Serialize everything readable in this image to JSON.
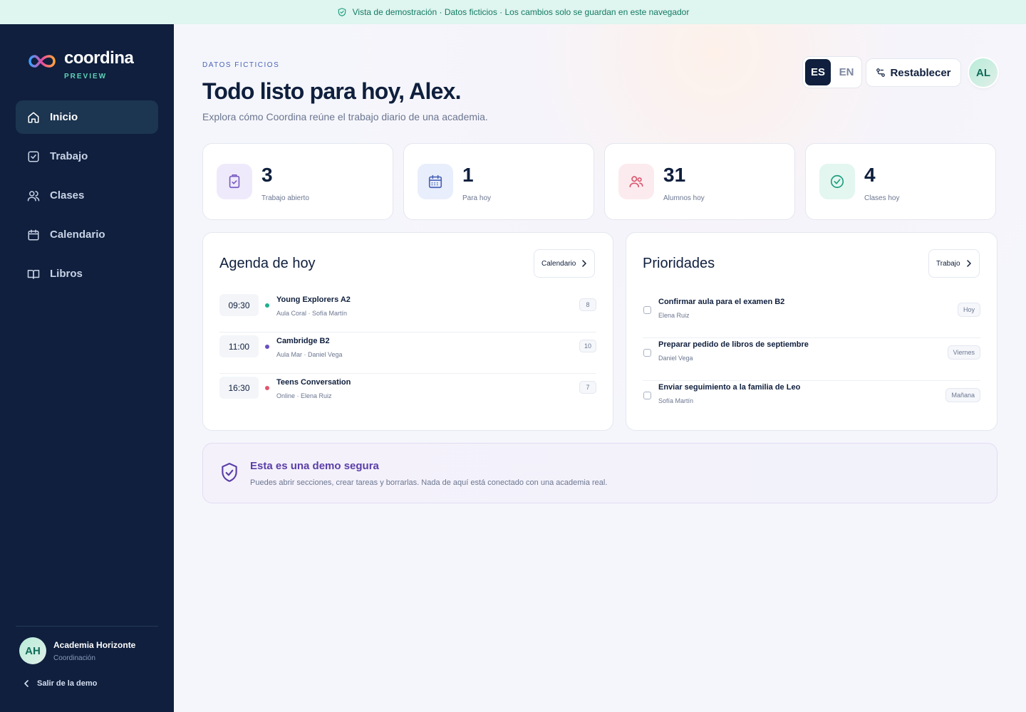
{
  "banner": {
    "text": "Vista de demostración · Datos ficticios · Los cambios solo se guardan en este navegador"
  },
  "brand": {
    "name": "coordina",
    "tag": "PREVIEW"
  },
  "sidebar": {
    "items": [
      {
        "label": "Inicio",
        "icon": "home-icon",
        "active": true
      },
      {
        "label": "Trabajo",
        "icon": "checkbox-icon"
      },
      {
        "label": "Clases",
        "icon": "users-icon"
      },
      {
        "label": "Calendario",
        "icon": "calendar-icon"
      },
      {
        "label": "Libros",
        "icon": "book-icon"
      }
    ],
    "org": {
      "initials": "AH",
      "name": "Academia Horizonte",
      "role": "Coordinación"
    },
    "exit_label": "Salir de la demo"
  },
  "header": {
    "eyebrow": "DATOS FICTICIOS",
    "title": "Todo listo para hoy, Alex.",
    "subtitle": "Explora cómo Coordina reúne el trabajo diario de una academia.",
    "lang_es": "ES",
    "lang_en": "EN",
    "reset_label": "Restablecer",
    "user_initials": "AL"
  },
  "stats": [
    {
      "value": "3",
      "label": "Trabajo abierto",
      "icon": "clipboard-check-icon",
      "color": "#7b5cc4"
    },
    {
      "value": "1",
      "label": "Para hoy",
      "icon": "calendar-icon",
      "color": "#4a63b8"
    },
    {
      "value": "31",
      "label": "Alumnos hoy",
      "icon": "users-icon",
      "color": "#d9576f"
    },
    {
      "value": "4",
      "label": "Clases hoy",
      "icon": "check-circle-icon",
      "color": "#1f9e7f"
    }
  ],
  "agenda": {
    "title": "Agenda de hoy",
    "button": "Calendario",
    "rows": [
      {
        "time": "09:30",
        "name": "Young Explorers A2",
        "sub": "Aula Coral · Sofía Martín",
        "count": "8",
        "color": "#1fb08f"
      },
      {
        "time": "11:00",
        "name": "Cambridge B2",
        "sub": "Aula Mar · Daniel Vega",
        "count": "10",
        "color": "#6a4fc2"
      },
      {
        "time": "16:30",
        "name": "Teens Conversation",
        "sub": "Online · Elena Ruiz",
        "count": "7",
        "color": "#e0566f"
      }
    ]
  },
  "priorities": {
    "title": "Prioridades",
    "button": "Trabajo",
    "rows": [
      {
        "name": "Confirmar aula para el examen B2",
        "owner": "Elena Ruiz",
        "due": "Hoy"
      },
      {
        "name": "Preparar pedido de libros de septiembre",
        "owner": "Daniel Vega",
        "due": "Viernes"
      },
      {
        "name": "Enviar seguimiento a la familia de Leo",
        "owner": "Sofía Martín",
        "due": "Mañana"
      }
    ]
  },
  "notice": {
    "title": "Esta es una demo segura",
    "text": "Puedes abrir secciones, crear tareas y borrarlas. Nada de aquí está conectado con una academia real."
  }
}
